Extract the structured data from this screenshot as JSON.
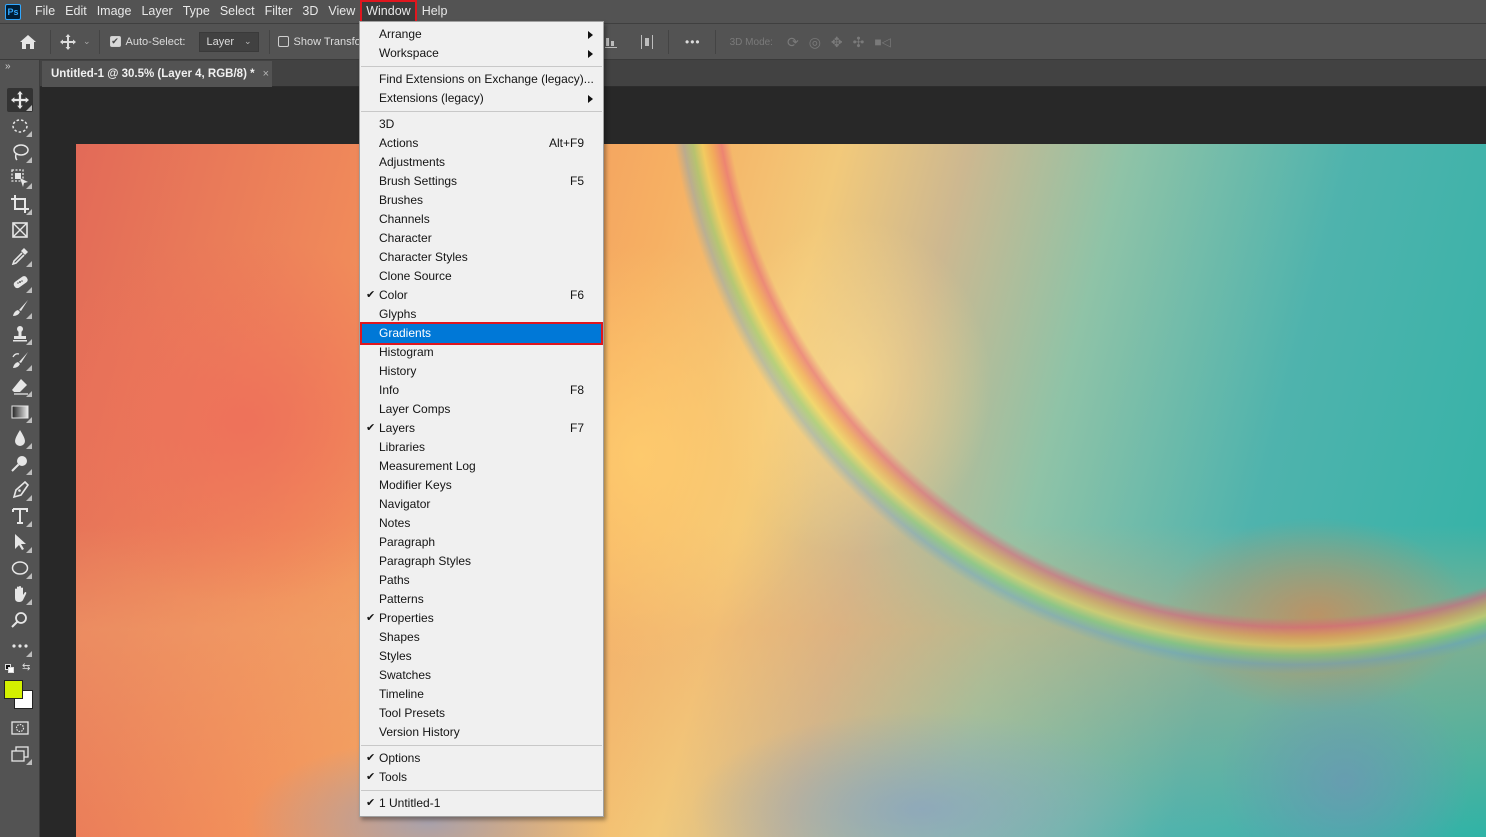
{
  "app": {
    "logo": "Ps",
    "accent_color": "#31a8ff",
    "highlight_color": "#0078d7",
    "annotation_color": "#e0161e"
  },
  "menubar": {
    "items": [
      "File",
      "Edit",
      "Image",
      "Layer",
      "Type",
      "Select",
      "Filter",
      "3D",
      "View",
      "Window",
      "Help"
    ],
    "active": "Window"
  },
  "options": {
    "home_icon": "home-icon",
    "move_icon": "move-tool-icon",
    "auto_select_label": "Auto-Select:",
    "auto_select_checked": true,
    "auto_select_target": "Layer",
    "show_transform_label": "Show Transform Controls",
    "show_transform_checked": false,
    "more_label": "•••",
    "mode_3d_label": "3D Mode:"
  },
  "document": {
    "tab_title": "Untitled-1 @ 30.5% (Layer 4, RGB/8) *",
    "close_glyph": "×",
    "zoom": "30.5%",
    "layer": "Layer 4",
    "color_mode": "RGB/8"
  },
  "toolbar": {
    "collapse_glyph": "»",
    "tools": [
      {
        "name": "move-tool",
        "active": true
      },
      {
        "name": "elliptical-marquee-tool"
      },
      {
        "name": "lasso-tool"
      },
      {
        "name": "object-selection-tool"
      },
      {
        "name": "crop-tool"
      },
      {
        "name": "frame-tool"
      },
      {
        "name": "eyedropper-tool"
      },
      {
        "name": "spot-healing-brush-tool"
      },
      {
        "name": "brush-tool"
      },
      {
        "name": "clone-stamp-tool"
      },
      {
        "name": "history-brush-tool"
      },
      {
        "name": "eraser-tool"
      },
      {
        "name": "gradient-tool"
      },
      {
        "name": "blur-tool"
      },
      {
        "name": "dodge-tool"
      },
      {
        "name": "pen-tool"
      },
      {
        "name": "type-tool"
      },
      {
        "name": "path-selection-tool"
      },
      {
        "name": "ellipse-tool"
      },
      {
        "name": "hand-tool"
      },
      {
        "name": "zoom-tool"
      },
      {
        "name": "edit-toolbar"
      }
    ],
    "foreground_color": "#d4f000",
    "background_color": "#ffffff"
  },
  "window_menu": {
    "groups": [
      [
        {
          "label": "Arrange",
          "submenu": true
        },
        {
          "label": "Workspace",
          "submenu": true
        }
      ],
      [
        {
          "label": "Find Extensions on Exchange (legacy)..."
        },
        {
          "label": "Extensions (legacy)",
          "submenu": true
        }
      ],
      [
        {
          "label": "3D"
        },
        {
          "label": "Actions",
          "shortcut": "Alt+F9"
        },
        {
          "label": "Adjustments"
        },
        {
          "label": "Brush Settings",
          "shortcut": "F5"
        },
        {
          "label": "Brushes"
        },
        {
          "label": "Channels"
        },
        {
          "label": "Character"
        },
        {
          "label": "Character Styles"
        },
        {
          "label": "Clone Source"
        },
        {
          "label": "Color",
          "shortcut": "F6",
          "checked": true
        },
        {
          "label": "Glyphs"
        },
        {
          "label": "Gradients",
          "highlighted": true
        },
        {
          "label": "Histogram"
        },
        {
          "label": "History"
        },
        {
          "label": "Info",
          "shortcut": "F8"
        },
        {
          "label": "Layer Comps"
        },
        {
          "label": "Layers",
          "shortcut": "F7",
          "checked": true
        },
        {
          "label": "Libraries"
        },
        {
          "label": "Measurement Log"
        },
        {
          "label": "Modifier Keys"
        },
        {
          "label": "Navigator"
        },
        {
          "label": "Notes"
        },
        {
          "label": "Paragraph"
        },
        {
          "label": "Paragraph Styles"
        },
        {
          "label": "Paths"
        },
        {
          "label": "Patterns"
        },
        {
          "label": "Properties",
          "checked": true
        },
        {
          "label": "Shapes"
        },
        {
          "label": "Styles"
        },
        {
          "label": "Swatches"
        },
        {
          "label": "Timeline"
        },
        {
          "label": "Tool Presets"
        },
        {
          "label": "Version History"
        }
      ],
      [
        {
          "label": "Options",
          "checked": true
        },
        {
          "label": "Tools",
          "checked": true
        }
      ],
      [
        {
          "label": "1 Untitled-1",
          "checked": true
        }
      ]
    ]
  }
}
